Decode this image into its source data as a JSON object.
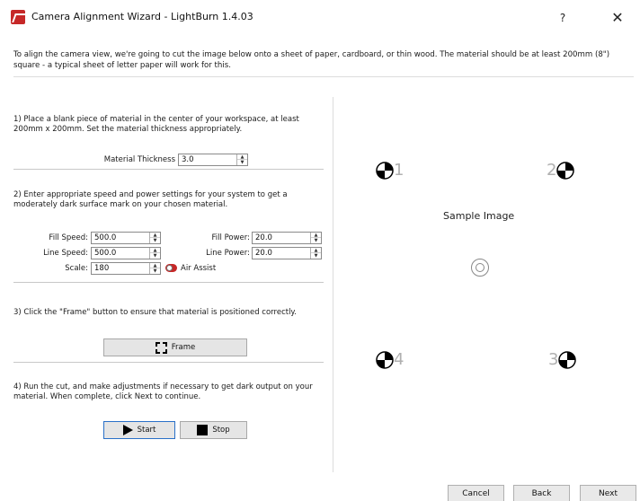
{
  "window": {
    "title": "Camera Alignment Wizard - LightBurn 1.4.03",
    "help_label": "?",
    "close_label": "✕"
  },
  "intro": "To align the camera view, we're going to cut the image below onto a sheet of paper, cardboard, or thin wood.  The material should be at least 200mm (8\") square - a typical sheet of letter paper will work for this.",
  "steps": {
    "step1": "1) Place a blank piece of material in the center of your workspace, at least 200mm x 200mm. Set the material thickness appropriately.",
    "step2": "2) Enter appropriate speed and power settings for your system to get a moderately dark surface mark on your chosen material.",
    "step3": "3) Click the \"Frame\" button to ensure that material is positioned correctly.",
    "step4": "4) Run the cut, and make adjustments if necessary to get dark output on your material. When complete, click Next to continue."
  },
  "fields": {
    "material_thickness": {
      "label": "Material Thickness",
      "value": "3.0"
    },
    "fill_speed": {
      "label": "Fill Speed:",
      "value": "500.0"
    },
    "fill_power": {
      "label": "Fill Power:",
      "value": "20.0"
    },
    "line_speed": {
      "label": "Line Speed:",
      "value": "500.0"
    },
    "line_power": {
      "label": "Line Power:",
      "value": "20.0"
    },
    "scale": {
      "label": "Scale:",
      "value": "180"
    },
    "air_assist": {
      "label": "Air Assist",
      "on": true
    }
  },
  "buttons": {
    "frame": "Frame",
    "start": "Start",
    "stop": "Stop",
    "cancel": "Cancel",
    "back": "Back",
    "next": "Next"
  },
  "sample": {
    "title": "Sample Image",
    "markers": [
      "1",
      "2",
      "3",
      "4"
    ]
  },
  "colors": {
    "accent": "#c62828",
    "focus": "#2a70c8"
  },
  "icons": {
    "app": "lightburn-logo-icon",
    "frame": "frame-corners-icon",
    "start": "play-icon",
    "stop": "stop-square-icon",
    "target": "concentric-circle-target-icon",
    "registration": "quartered-circle-marker-icon"
  }
}
